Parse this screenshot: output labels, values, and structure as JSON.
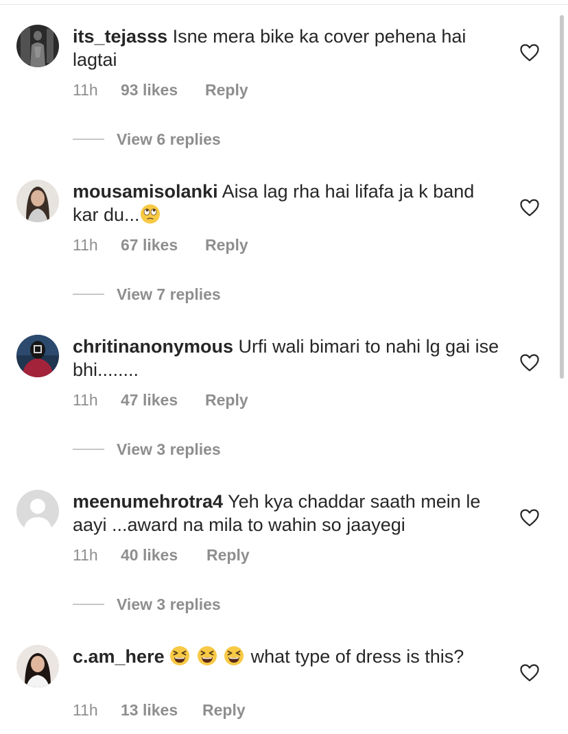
{
  "colors": {
    "text_primary": "#262626",
    "text_secondary": "#8e8e8e",
    "divider": "#c7c7c7"
  },
  "comments": [
    {
      "username": "its_tejasss",
      "text": "Isne mera bike ka cover pehena hai lagtai",
      "emojis": [],
      "text_after_emojis": "",
      "time": "11h",
      "likes": "93 likes",
      "reply": "Reply",
      "view_replies": "View 6 replies",
      "avatar_icon": "dark-photo-avatar"
    },
    {
      "username": "mousamisolanki",
      "text": "Aisa lag rha hai lifafa ja k band kar du...",
      "emojis": [
        "face-with-rolling-eyes"
      ],
      "text_after_emojis": "",
      "time": "11h",
      "likes": "67 likes",
      "reply": "Reply",
      "view_replies": "View 7 replies",
      "avatar_icon": "woman-photo-avatar"
    },
    {
      "username": "chritinanonymous",
      "text": "Urfi wali bimari to nahi lg gai ise bhi........",
      "emojis": [],
      "text_after_emojis": "",
      "time": "11h",
      "likes": "47 likes",
      "reply": "Reply",
      "view_replies": "View 3 replies",
      "avatar_icon": "masked-figure-avatar"
    },
    {
      "username": "meenumehrotra4",
      "text": "Yeh kya chaddar saath mein le aayi ...award na mila to wahin so jaayegi",
      "emojis": [],
      "text_after_emojis": "",
      "time": "11h",
      "likes": "40 likes",
      "reply": "Reply",
      "view_replies": "View 3 replies",
      "avatar_icon": "default-user-avatar"
    },
    {
      "username": "c.am_here",
      "text": "",
      "emojis": [
        "grinning-squinting-face",
        "grinning-squinting-face",
        "grinning-squinting-face"
      ],
      "text_after_emojis": "what type of dress is this?",
      "time": "11h",
      "likes": "13 likes",
      "reply": "Reply",
      "view_replies": "",
      "avatar_icon": "woman-photo-avatar"
    }
  ]
}
